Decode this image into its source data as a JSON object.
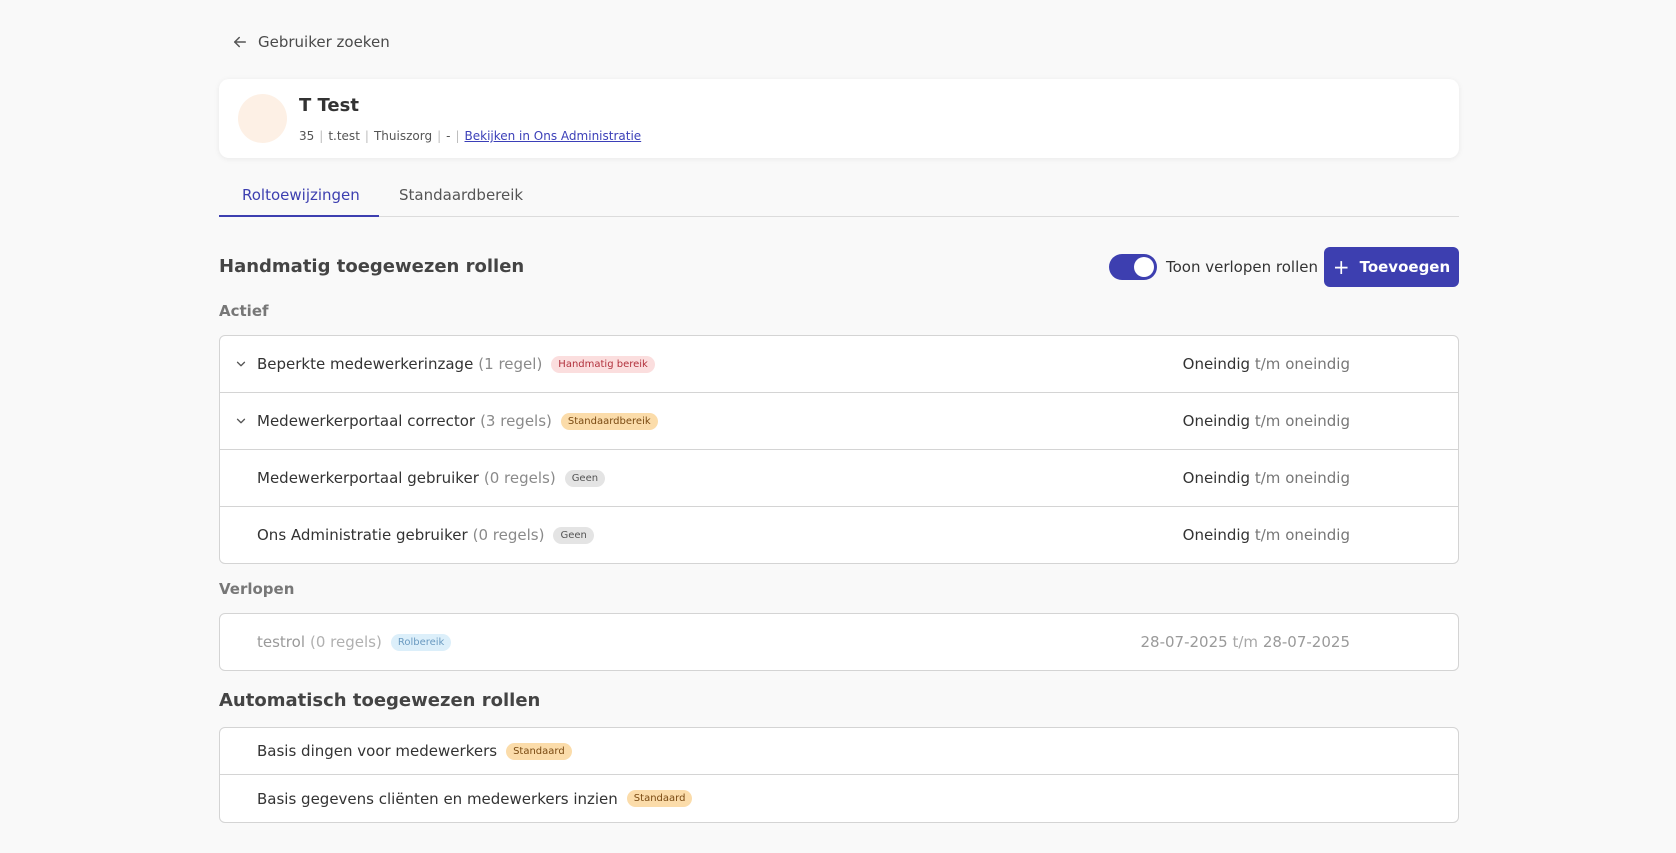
{
  "nav": {
    "back_label": "Gebruiker zoeken"
  },
  "user": {
    "name": "T Test",
    "meta": [
      "35",
      "t.test",
      "Thuiszorg",
      "-"
    ],
    "link_label": "Bekijken in Ons Administratie"
  },
  "tabs": [
    {
      "label": "Roltoewijzingen",
      "active": true
    },
    {
      "label": "Standaardbereik",
      "active": false
    }
  ],
  "manual": {
    "title": "Handmatig toegewezen rollen",
    "toggle_label": "Toon verlopen rollen",
    "toggle_on": true,
    "add_label": "Toevoegen",
    "active_label": "Actief",
    "active_rows": [
      {
        "name": "Beperkte medewerkerinzage",
        "count": "(1 regel)",
        "badge": "Handmatig bereik",
        "from": "Oneindig",
        "sep": "t/m",
        "to": "oneindig",
        "expandable": true
      },
      {
        "name": "Medewerkerportaal corrector",
        "count": "(3 regels)",
        "badge": "Standaardbereik",
        "from": "Oneindig",
        "sep": "t/m",
        "to": "oneindig",
        "expandable": true
      },
      {
        "name": "Medewerkerportaal gebruiker",
        "count": "(0 regels)",
        "badge": "Geen",
        "from": "Oneindig",
        "sep": "t/m",
        "to": "oneindig",
        "expandable": false
      },
      {
        "name": "Ons Administratie gebruiker",
        "count": "(0 regels)",
        "badge": "Geen",
        "from": "Oneindig",
        "sep": "t/m",
        "to": "oneindig",
        "expandable": false
      }
    ],
    "expired_label": "Verlopen",
    "expired_rows": [
      {
        "name": "testrol",
        "count": "(0 regels)",
        "badge": "Rolbereik",
        "from": "28-07-2025",
        "sep": "t/m",
        "to": "28-07-2025"
      }
    ]
  },
  "automatic": {
    "title": "Automatisch toegewezen rollen",
    "rows": [
      {
        "name": "Basis dingen voor medewerkers",
        "badge": "Standaard"
      },
      {
        "name": "Basis gegevens cliënten en medewerkers inzien",
        "badge": "Standaard"
      }
    ]
  },
  "colors": {
    "accent": "#3d3fb0",
    "background": "#f9f9f9"
  }
}
